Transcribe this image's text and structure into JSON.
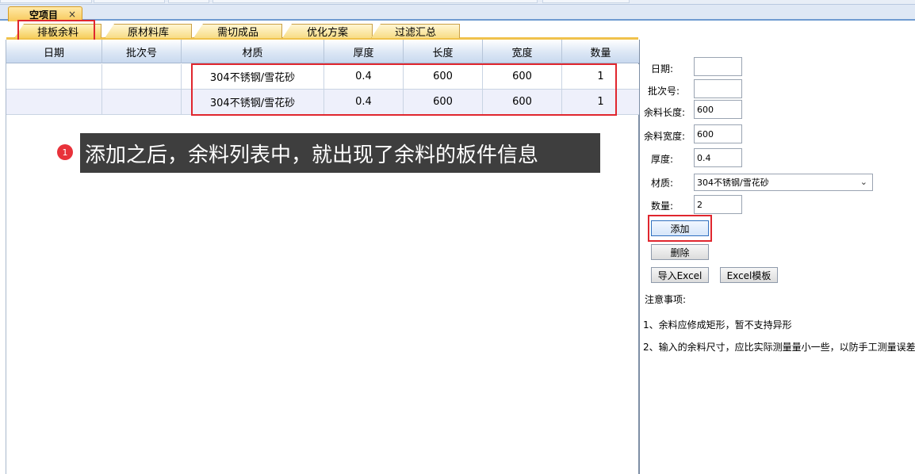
{
  "document_tab": {
    "label": "空项目",
    "close": "×"
  },
  "sub_tabs": [
    {
      "label": "排板余料",
      "active": true
    },
    {
      "label": "原材料库",
      "active": false
    },
    {
      "label": "需切成品",
      "active": false
    },
    {
      "label": "优化方案",
      "active": false
    },
    {
      "label": "过滤汇总",
      "active": false
    }
  ],
  "grid": {
    "columns": [
      "日期",
      "批次号",
      "材质",
      "厚度",
      "长度",
      "宽度",
      "数量"
    ],
    "rows": [
      [
        "",
        "",
        "304不锈钢/雪花砂",
        "0.4",
        "600",
        "600",
        "1"
      ],
      [
        "",
        "",
        "304不锈钢/雪花砂",
        "0.4",
        "600",
        "600",
        "1"
      ]
    ]
  },
  "annotation": {
    "step": "1",
    "text": "添加之后，余料列表中，就出现了余料的板件信息"
  },
  "form": {
    "date_label": "日期:",
    "date_value": "",
    "batch_label": "批次号:",
    "batch_value": "",
    "length_label": "余料长度:",
    "length_value": "600",
    "width_label": "余料宽度:",
    "width_value": "600",
    "thickness_label": "厚度:",
    "thickness_value": "0.4",
    "material_label": "材质:",
    "material_value": "304不锈钢/雪花砂",
    "quantity_label": "数量:",
    "quantity_value": "2",
    "add_button": "添加",
    "delete_button": "删除",
    "import_button": "导入Excel",
    "template_button": "Excel模板",
    "notes_title": "注意事项:",
    "note_1": "1、余料应修成矩形，暂不支持异形",
    "note_2": "2、输入的余料尺寸，应比实际测量量小一些，以防手工测量误差"
  },
  "colors": {
    "highlight_red": "#e0262e",
    "tab_gold": "#f6cf5d",
    "header_blue": "#c9d9ef",
    "annotation_bg": "#3e3e3e",
    "badge_red": "#e8323a"
  }
}
